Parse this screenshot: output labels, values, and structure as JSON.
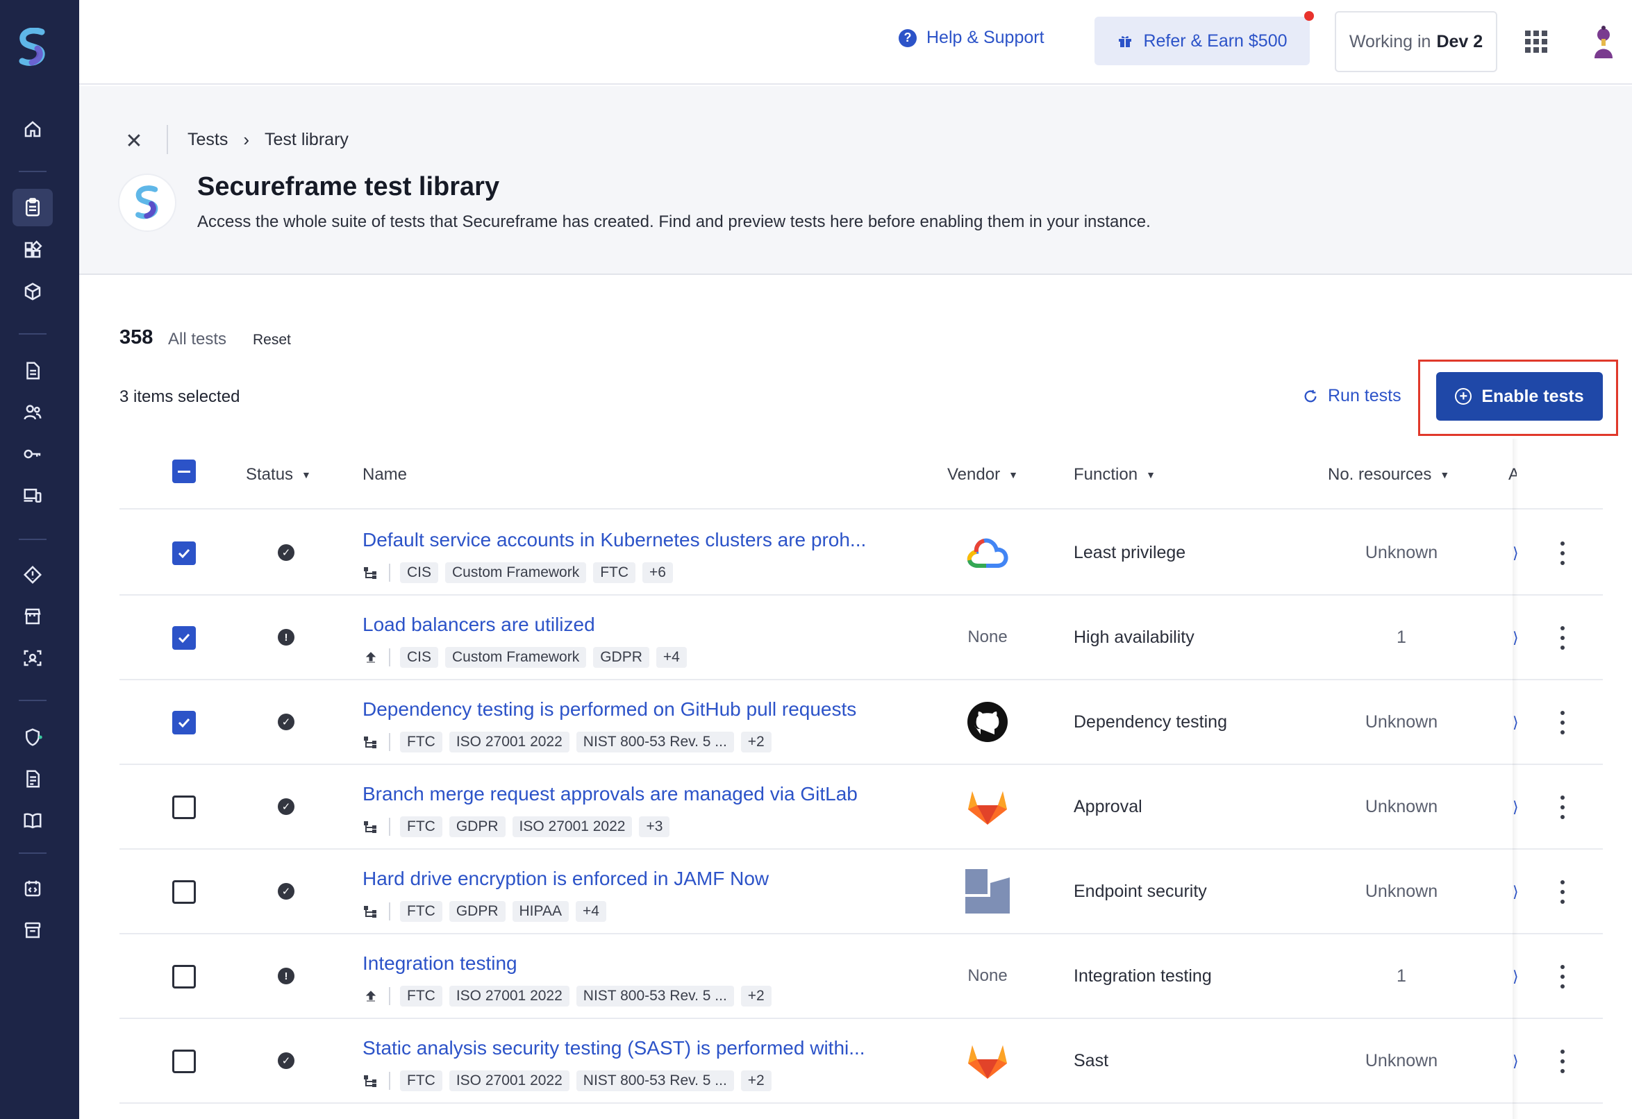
{
  "topbar": {
    "help_label": "Help & Support",
    "refer_label": "Refer & Earn $500",
    "working_prefix": "Working in",
    "working_env": "Dev 2"
  },
  "breadcrumb": {
    "items": [
      "Tests",
      "Test library"
    ]
  },
  "page": {
    "title": "Secureframe test library",
    "subtitle": "Access the whole suite of tests that Secureframe has created. Find and preview tests here before enabling them in your instance."
  },
  "summary": {
    "count": "358",
    "count_label": "All tests",
    "reset_label": "Reset",
    "selected_label": "3 items selected"
  },
  "actions": {
    "run_tests": "Run tests",
    "enable_tests": "Enable tests"
  },
  "table": {
    "columns": {
      "status": "Status",
      "name": "Name",
      "vendor": "Vendor",
      "function": "Function",
      "resources": "No. resources",
      "cut": "A"
    },
    "rows": [
      {
        "checked": true,
        "status": "pass",
        "name": "Default service accounts in Kubernetes clusters are proh...",
        "kind": "integration",
        "tags": [
          "CIS",
          "Custom Framework",
          "FTC",
          "+6"
        ],
        "vendor": "google-cloud",
        "vendor_text": "",
        "function": "Least privilege",
        "resources": "Unknown"
      },
      {
        "checked": true,
        "status": "warn",
        "name": "Load balancers are utilized",
        "kind": "upload",
        "tags": [
          "CIS",
          "Custom Framework",
          "GDPR",
          "+4"
        ],
        "vendor": "none",
        "vendor_text": "None",
        "function": "High availability",
        "resources": "1"
      },
      {
        "checked": true,
        "status": "pass",
        "name": "Dependency testing is performed on GitHub pull requests",
        "kind": "integration",
        "tags": [
          "FTC",
          "ISO 27001 2022",
          "NIST 800-53 Rev. 5 ...",
          "+2"
        ],
        "vendor": "github",
        "vendor_text": "",
        "function": "Dependency testing",
        "resources": "Unknown"
      },
      {
        "checked": false,
        "status": "pass",
        "name": "Branch merge request approvals are managed via GitLab",
        "kind": "integration",
        "tags": [
          "FTC",
          "GDPR",
          "ISO 27001 2022",
          "+3"
        ],
        "vendor": "gitlab",
        "vendor_text": "",
        "function": "Approval",
        "resources": "Unknown"
      },
      {
        "checked": false,
        "status": "pass",
        "name": "Hard drive encryption is enforced in JAMF Now",
        "kind": "integration",
        "tags": [
          "FTC",
          "GDPR",
          "HIPAA",
          "+4"
        ],
        "vendor": "jamf",
        "vendor_text": "",
        "function": "Endpoint security",
        "resources": "Unknown"
      },
      {
        "checked": false,
        "status": "warn",
        "name": "Integration testing",
        "kind": "upload",
        "tags": [
          "FTC",
          "ISO 27001 2022",
          "NIST 800-53 Rev. 5 ...",
          "+2"
        ],
        "vendor": "none",
        "vendor_text": "None",
        "function": "Integration testing",
        "resources": "1"
      },
      {
        "checked": false,
        "status": "pass",
        "name": "Static analysis security testing (SAST) is performed withi...",
        "kind": "integration",
        "tags": [
          "FTC",
          "ISO 27001 2022",
          "NIST 800-53 Rev. 5 ...",
          "+2"
        ],
        "vendor": "gitlab",
        "vendor_text": "",
        "function": "Sast",
        "resources": "Unknown"
      }
    ]
  },
  "colors": {
    "sidebar": "#1d2547",
    "accent": "#2c53c8",
    "primary_button": "#1f48a8",
    "highlight": "#e0392b"
  }
}
